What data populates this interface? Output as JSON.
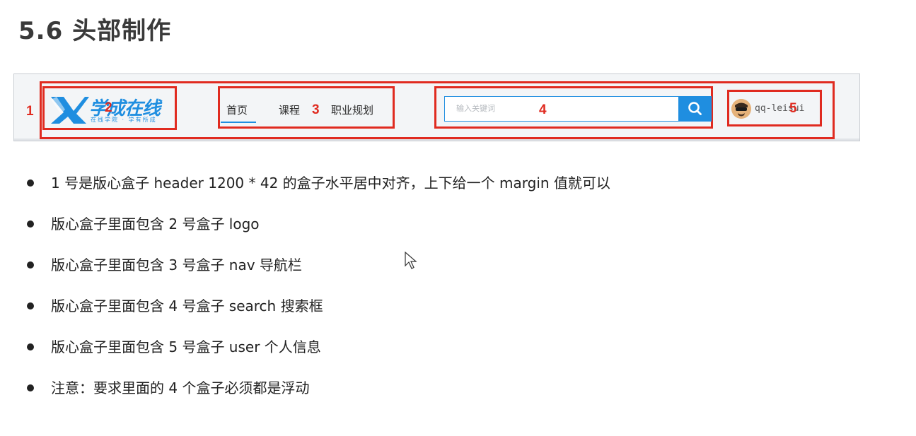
{
  "title": "5.6 头部制作",
  "screenshot": {
    "markers": [
      "1",
      "2",
      "3",
      "4",
      "5"
    ],
    "logo": {
      "main_text": "学成在线",
      "sub_text": "在线学院 · 学有所成"
    },
    "nav": {
      "items": [
        "首页",
        "课程",
        "职业规划"
      ],
      "active_index": 0
    },
    "search": {
      "placeholder": "输入关键词",
      "button_icon": "search-icon"
    },
    "user": {
      "name": "qq-lei",
      "name_tail": "ui"
    },
    "colors": {
      "brand": "#1f8ee0",
      "annotation": "#e02b20"
    }
  },
  "bullets": [
    "1 号是版心盒子 header 1200 * 42 的盒子水平居中对齐，上下给一个 margin 值就可以",
    "版心盒子里面包含 2 号盒子 logo",
    "版心盒子里面包含 3 号盒子 nav 导航栏",
    "版心盒子里面包含 4 号盒子 search 搜索框",
    "版心盒子里面包含 5 号盒子 user 个人信息",
    "注意：要求里面的 4 个盒子必须都是浮动"
  ]
}
